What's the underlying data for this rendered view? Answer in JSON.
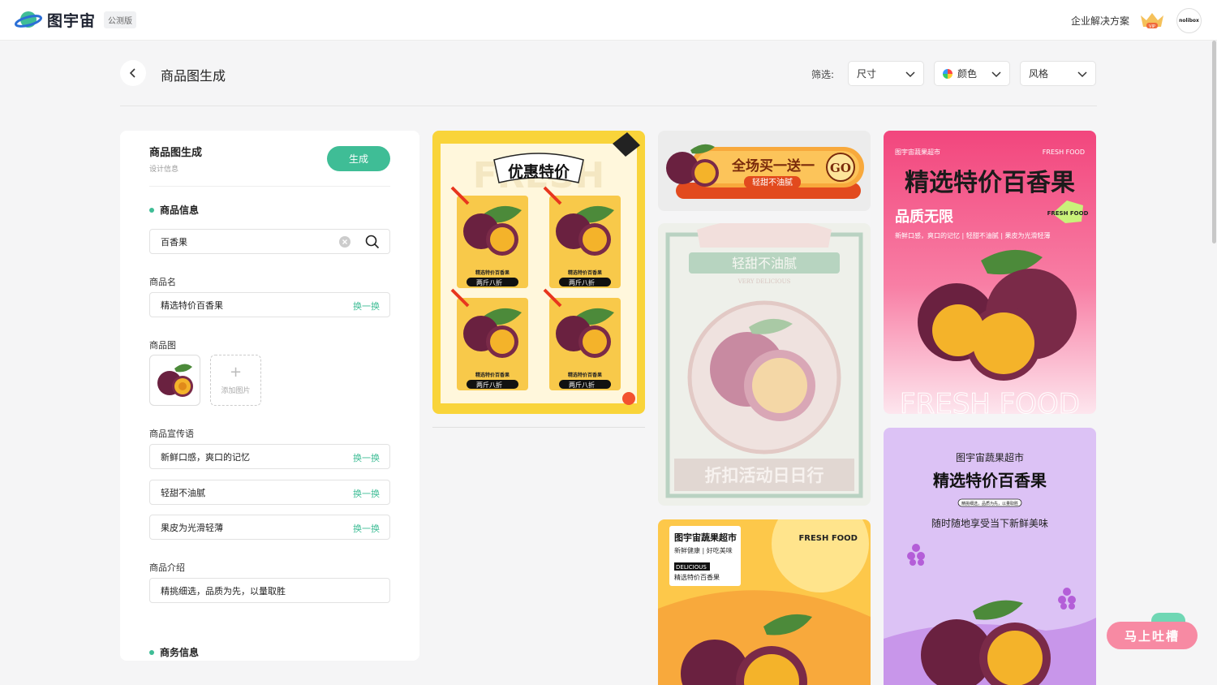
{
  "app": {
    "name": "图宇宙",
    "beta_badge": "公测版",
    "enterprise_link": "企业解决方案",
    "avatar_text": "nolibox",
    "vip_text": "VIP"
  },
  "page": {
    "title": "商品图生成",
    "filter_label": "筛选:"
  },
  "filters": {
    "size": "尺寸",
    "color": "颜色",
    "style": "风格"
  },
  "panel": {
    "title": "商品图生成",
    "subtitle": "设计信息",
    "generate_label": "生成",
    "product_section": "商品信息",
    "search_value": "百香果",
    "name_label": "商品名",
    "name_value": "精选特价百香果",
    "swap_label": "换一换",
    "image_label": "商品图",
    "add_image_label": "添加图片",
    "slogan_label": "商品宣传语",
    "slogans": [
      "新鲜口感，爽口的记忆",
      "轻甜不油腻",
      "果皮为光滑轻薄"
    ],
    "intro_label": "商品介绍",
    "intro_value": "精挑细选，品质为先，以量取胜",
    "business_section": "商务信息"
  },
  "cards": {
    "c1": {
      "headline": "优惠特价",
      "tile_name": "精选特价百香果",
      "tile_offer": "两斤八折",
      "bg_word": "FRESH"
    },
    "c2": {
      "headline": "全场买一送一",
      "sub": "轻甜不油腻",
      "go": "GO"
    },
    "c3": {
      "headline": "轻甜不油腻",
      "en": "VERY DELICIOUS",
      "bottom": "折扣活动日日行"
    },
    "c4": {
      "store": "图宇宙蔬果超市",
      "tag": "新鲜健康 | 好吃美味",
      "badge": "DELICIOUS",
      "name": "精选特价百香果",
      "en": "FRESH\nFOOD"
    },
    "c5": {
      "store": "图宇宙蔬果超市",
      "en_top": "FRESH FOOD",
      "headline": "精选特价百香果",
      "sub": "品质无限",
      "badge": "FRESH FOOD",
      "tags": "新鲜口感，爽口的记忆 | 轻甜不油腻 | 果皮为光滑轻薄",
      "bottom": "FRESH FOOD"
    },
    "c6": {
      "store": "图宇宙蔬果超市",
      "headline": "精选特价百香果",
      "pill": "精挑细选，品质为先，以量取胜",
      "sub": "随时随地享受当下新鲜美味"
    }
  },
  "feedback_label": "马上吐槽",
  "colors": {
    "accent": "#3fbd96",
    "pink": "#f2467d",
    "yellow": "#f9d43a",
    "purple": "#dcc2f5",
    "orange": "#f8a93c"
  }
}
